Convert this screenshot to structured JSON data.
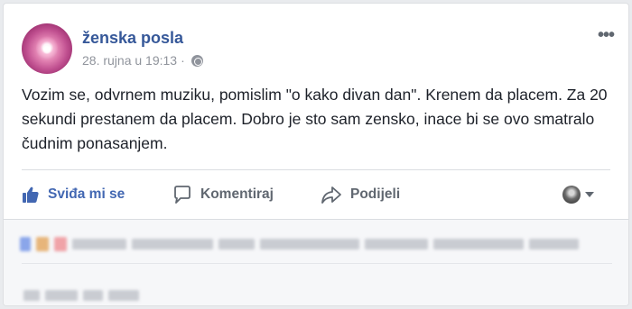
{
  "post": {
    "author": "ženska posla",
    "timestamp": "28. rujna u 19:13",
    "separator": "·",
    "privacy_icon": "globe-icon",
    "menu_icon": "more-options-icon",
    "text": "Vozim se, odvrnem muziku, pomislim \"o kako divan dan\". Krenem da placem. Za 20 sekundi prestanem da placem. Dobro je sto sam zensko, inace bi se ovo smatralo čudnim ponasanjem."
  },
  "actions": {
    "like_label": "Sviđa mi se",
    "comment_label": "Komentiraj",
    "share_label": "Podijeli"
  },
  "colors": {
    "author": "#365899",
    "like_active": "#4267b2",
    "action_text": "#606770",
    "meta_text": "#90949c"
  }
}
